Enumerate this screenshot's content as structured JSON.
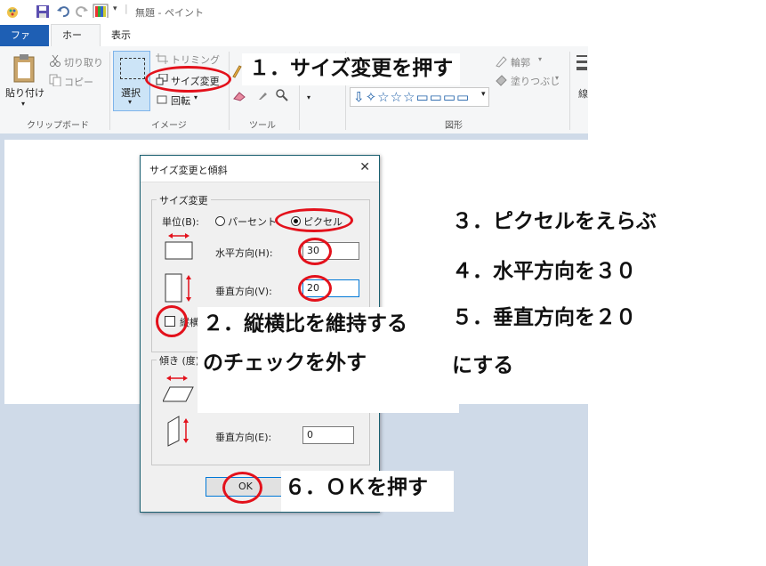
{
  "window": {
    "title": "無題 - ペイント"
  },
  "tabs": {
    "file": "ファイル",
    "home": "ホーム",
    "view": "表示"
  },
  "ribbon": {
    "clipboard": {
      "paste": "貼り付け",
      "cut": "切り取り",
      "copy": "コピー",
      "group": "クリップボード"
    },
    "image": {
      "select": "選択",
      "crop": "トリミング",
      "resize": "サイズ変更",
      "rotate": "回転",
      "group": "イメージ"
    },
    "tools": {
      "group": "ツール"
    },
    "shapes": {
      "outline": "輪郭",
      "fill": "塗りつぶし",
      "group": "図形"
    }
  },
  "dialog": {
    "title": "サイズ変更と傾斜",
    "resize_section": "サイズ変更",
    "unit_label": "単位(B):",
    "percent_option": "パーセント",
    "pixel_option": "ピクセル",
    "unit_selected": "pixel",
    "horizontal_label": "水平方向(H):",
    "horizontal_value": "30",
    "vertical_label": "垂直方向(V):",
    "vertical_value": "20",
    "keep_aspect_label": "縦横比を維持する",
    "keep_aspect_visible": "縦横",
    "keep_aspect_checked": false,
    "skew_section": "傾き (度)",
    "skew_vertical_label": "垂直方向(E):",
    "skew_vertical_value": "0",
    "ok": "OK"
  },
  "annotations": {
    "step1": "１．サイズ変更を押す",
    "step2_line1": "２．縦横比を維持する",
    "step2_line2": "のチェックを外す",
    "step3": "３．ピクセルをえらぶ",
    "step4": "４．水平方向を３０",
    "step5": "５．垂直方向を２０",
    "step5b": "にする",
    "step6": "６．ＯＫを押す"
  },
  "colors": {
    "accent": "#1e5fb4",
    "highlight": "#e3111b",
    "workspace": "#cfdae8"
  }
}
